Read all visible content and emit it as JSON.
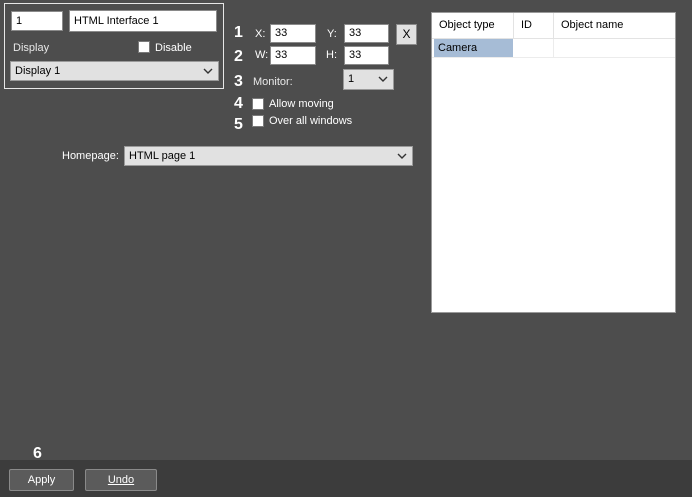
{
  "identity": {
    "id_value": "1",
    "name_value": "HTML Interface 1",
    "display_label": "Display",
    "disable_label": "Disable",
    "display_select": "Display 1"
  },
  "position": {
    "markers": [
      "1",
      "2",
      "3",
      "4",
      "5",
      "6"
    ],
    "x_label": "X:",
    "x_value": "33",
    "y_label": "Y:",
    "y_value": "33",
    "w_label": "W:",
    "w_value": "33",
    "h_label": "H:",
    "h_value": "33",
    "x_button": "X",
    "monitor_label": "Monitor:",
    "monitor_value": "1",
    "allow_moving_label": "Allow moving",
    "over_all_windows_label": "Over all windows"
  },
  "homepage": {
    "label": "Homepage:",
    "value": "HTML page 1"
  },
  "objects_table": {
    "columns": [
      "Object type",
      "ID",
      "Object name"
    ],
    "rows": [
      {
        "type": "Camera",
        "id": "",
        "name": ""
      }
    ]
  },
  "footer": {
    "apply_label": "Apply",
    "undo_label": "Undo"
  },
  "colors": {
    "background": "#4d4d4d",
    "footer": "#3c3c3c",
    "selection": "#a6bcd6"
  }
}
